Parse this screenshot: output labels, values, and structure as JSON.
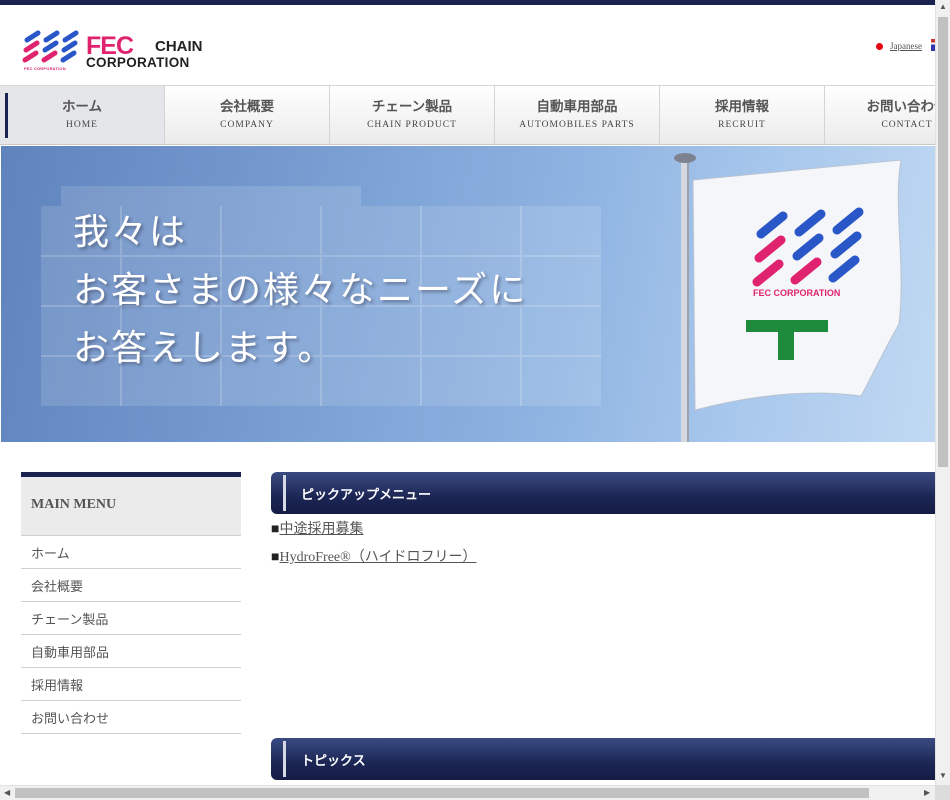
{
  "logo": {
    "brand": "FEC",
    "chain": "CHAIN",
    "corporation": "CORPORATION",
    "sub": "FEC CORPORATION"
  },
  "language": {
    "label": "Japanese"
  },
  "nav": {
    "items": [
      {
        "jp": "ホーム",
        "en": "HOME"
      },
      {
        "jp": "会社概要",
        "en": "COMPANY"
      },
      {
        "jp": "チェーン製品",
        "en": "CHAIN PRODUCT"
      },
      {
        "jp": "自動車用部品",
        "en": "AUTOMOBILES PARTS"
      },
      {
        "jp": "採用情報",
        "en": "RECRUIT"
      },
      {
        "jp": "お問い合わせ",
        "en": "CONTACT"
      }
    ],
    "active_index": 0
  },
  "hero": {
    "lines": [
      "我々は",
      "お客さまの様々なニーズに",
      "お答えします。"
    ],
    "flag_text": "FEC CORPORATION"
  },
  "sidebar": {
    "heading": "MAIN MENU",
    "items": [
      "ホーム",
      "会社概要",
      "チェーン製品",
      "自動車用部品",
      "採用情報",
      "お問い合わせ"
    ]
  },
  "pickup": {
    "title": "ピックアップメニュー",
    "links": [
      {
        "bullet": "■",
        "label": "中途採用募集"
      },
      {
        "bullet": "■",
        "label": "HydroFree®（ハイドロフリー）"
      }
    ]
  },
  "topics": {
    "title": "トピックス"
  },
  "colors": {
    "navy": "#1a2350",
    "brand_pink": "#e0236f",
    "brand_blue": "#2a57c8",
    "sky": "#7a9fd3"
  },
  "icons": {
    "lang": "japan-flag-icon",
    "scroll_up": "up-arrow-icon",
    "scroll_down": "down-arrow-icon",
    "scroll_left": "left-arrow-icon",
    "scroll_right": "right-arrow-icon"
  }
}
